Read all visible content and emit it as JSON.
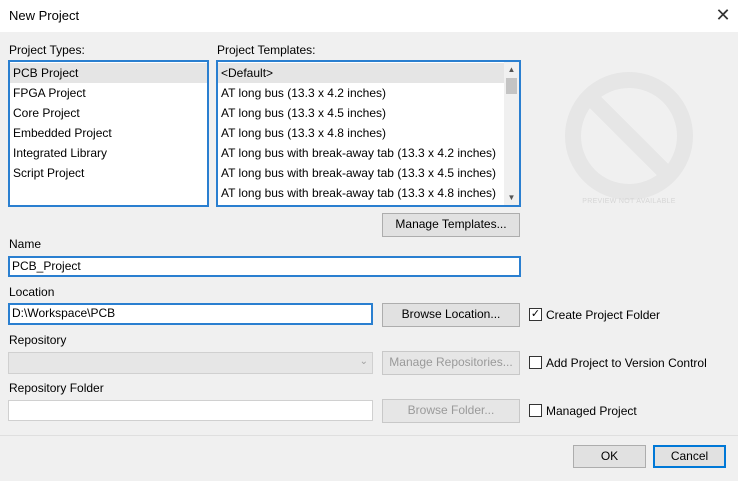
{
  "window": {
    "title": "New Project",
    "close_glyph": "✕"
  },
  "project_types": {
    "label": "Project Types:",
    "items": [
      "PCB Project",
      "FPGA Project",
      "Core Project",
      "Embedded Project",
      "Integrated Library",
      "Script Project"
    ],
    "selected": 0
  },
  "project_templates": {
    "label": "Project Templates:",
    "items": [
      "<Default>",
      "AT long bus (13.3 x 4.2 inches)",
      "AT long bus (13.3 x 4.5 inches)",
      "AT long bus (13.3 x 4.8 inches)",
      "AT long bus with break-away tab (13.3 x 4.2 inches)",
      "AT long bus with break-away tab (13.3 x 4.5 inches)",
      "AT long bus with break-away tab (13.3 x 4.8 inches)"
    ],
    "selected": 0
  },
  "preview": {
    "text": "PREVIEW NOT AVAILABLE",
    "icon": "no-preview-icon"
  },
  "manage_templates_label": "Manage Templates...",
  "name": {
    "label": "Name",
    "value": "PCB_Project"
  },
  "location": {
    "label": "Location",
    "value": "D:\\Workspace\\PCB",
    "browse_label": "Browse Location..."
  },
  "create_project_folder": {
    "label": "Create Project Folder",
    "checked": true
  },
  "repository": {
    "label": "Repository",
    "value": "",
    "manage_label": "Manage Repositories..."
  },
  "version_control": {
    "label": "Add Project to Version Control",
    "checked": false
  },
  "repository_folder": {
    "label": "Repository Folder",
    "value": "",
    "browse_label": "Browse Folder..."
  },
  "managed_project": {
    "label": "Managed Project",
    "checked": false
  },
  "footer": {
    "ok_label": "OK",
    "cancel_label": "Cancel"
  },
  "colors": {
    "accent": "#2a7fd0",
    "selection": "#e5e5e5",
    "preview_icon": "#e6e6e6"
  }
}
